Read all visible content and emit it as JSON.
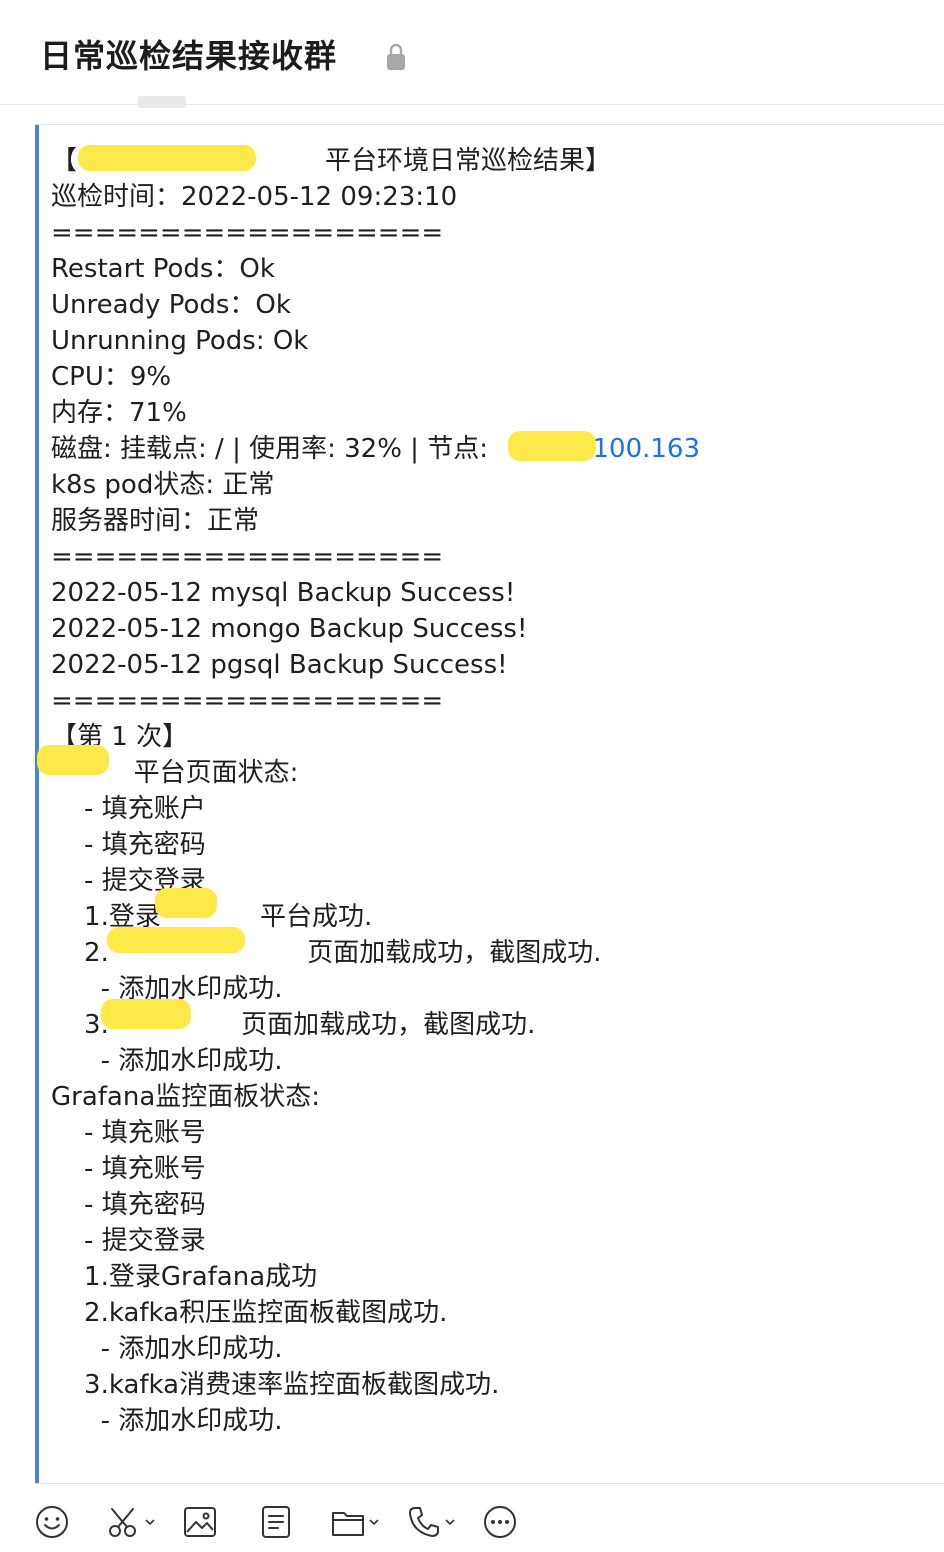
{
  "header": {
    "title": "日常巡检结果接收群",
    "lock_icon": "lock-icon"
  },
  "message": {
    "lines": [
      "【                              平台环境日常巡检结果】",
      "巡检时间：2022-05-12 09:23:10",
      "==================",
      "Restart Pods：Ok",
      "Unready Pods：Ok",
      "Unrunning Pods: Ok",
      "CPU：9%",
      "内存：71%",
      "磁盘: 挂载点: / | 使用率: 32% | 节点: ",
      "k8s pod状态: 正常",
      "服务器时间：正常",
      "==================",
      "2022-05-12 mysql Backup Success!",
      "2022-05-12 mongo Backup Success!",
      "2022-05-12 pgsql Backup Success!",
      "==================",
      "【第 1 次】",
      "          平台页面状态:",
      "    - 填充账户",
      "    - 填充密码",
      "    - 提交登录",
      "    1.登录            平台成功.",
      "    2.                        页面加载成功，截图成功.",
      "      - 添加水印成功.",
      "    3.                页面加载成功，截图成功.",
      "      - 添加水印成功.",
      "Grafana监控面板状态:",
      "    - 填充账号",
      "    - 填充账号",
      "    - 填充密码",
      "    - 提交登录",
      "    1.登录Grafana成功",
      "    2.kafka积压监控面板截图成功.",
      "      - 添加水印成功.",
      "    3.kafka消费速率监控面板截图成功.",
      "      - 添加水印成功."
    ],
    "node_ip_suffix": ".100.163",
    "ip_color": "#1a73e8"
  },
  "toolbar": {
    "icons": [
      "emoji-icon",
      "scissors-icon",
      "image-icon",
      "document-icon",
      "folder-icon",
      "phone-icon",
      "more-icon"
    ]
  },
  "colors": {
    "accent_bar": "#4a86d8",
    "redaction": "#ffe94a"
  }
}
